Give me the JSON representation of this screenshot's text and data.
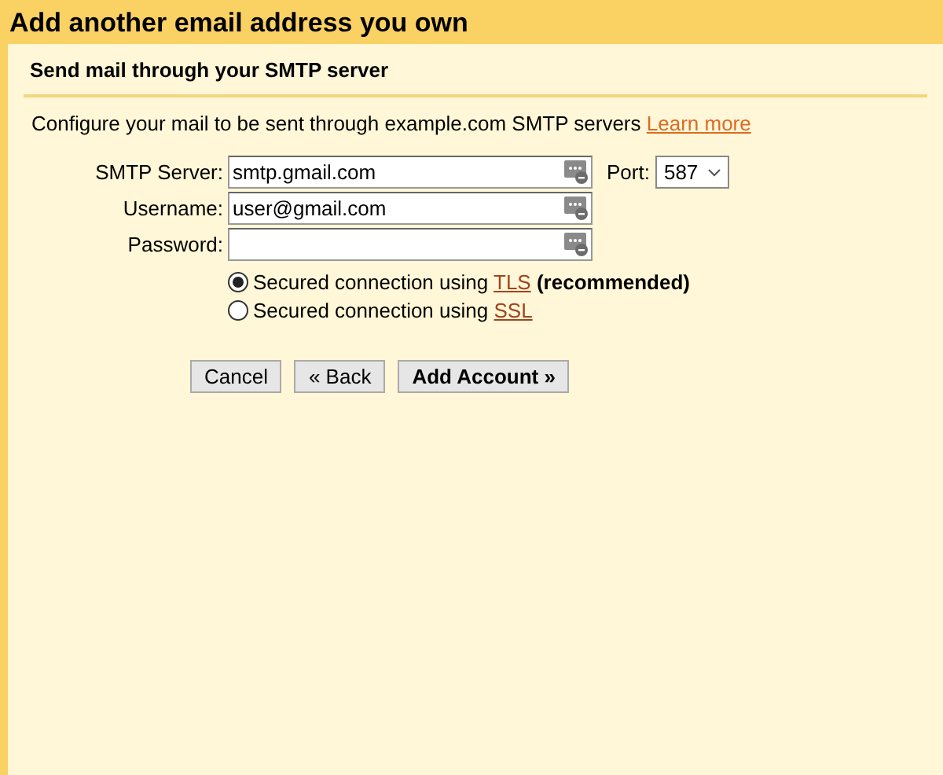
{
  "window": {
    "title": "Add another email address you own"
  },
  "section": {
    "title": "Send mail through your SMTP server"
  },
  "intro": {
    "text": "Configure your mail to be sent through example.com SMTP servers",
    "link": "Learn more"
  },
  "fields": [
    {
      "label": "SMTP Server:",
      "value": "smtp.gmail.com",
      "kind": "text"
    },
    {
      "label": "Username:",
      "value": "user@gmail.com",
      "kind": "text"
    },
    {
      "label": "Password:",
      "kind": "password"
    }
  ],
  "port": {
    "label": "Port:",
    "value": "587"
  },
  "security": [
    {
      "text": "Secured connection using",
      "link": "TLS",
      "note": "(recommended)",
      "selected": true
    },
    {
      "text": "Secured connection using",
      "link": "SSL",
      "selected": false
    }
  ],
  "buttons": [
    {
      "label": "Cancel",
      "kind": "plain"
    },
    {
      "label": "« Back",
      "kind": "plain"
    },
    {
      "label": "Add Account »",
      "kind": "primary"
    }
  ]
}
